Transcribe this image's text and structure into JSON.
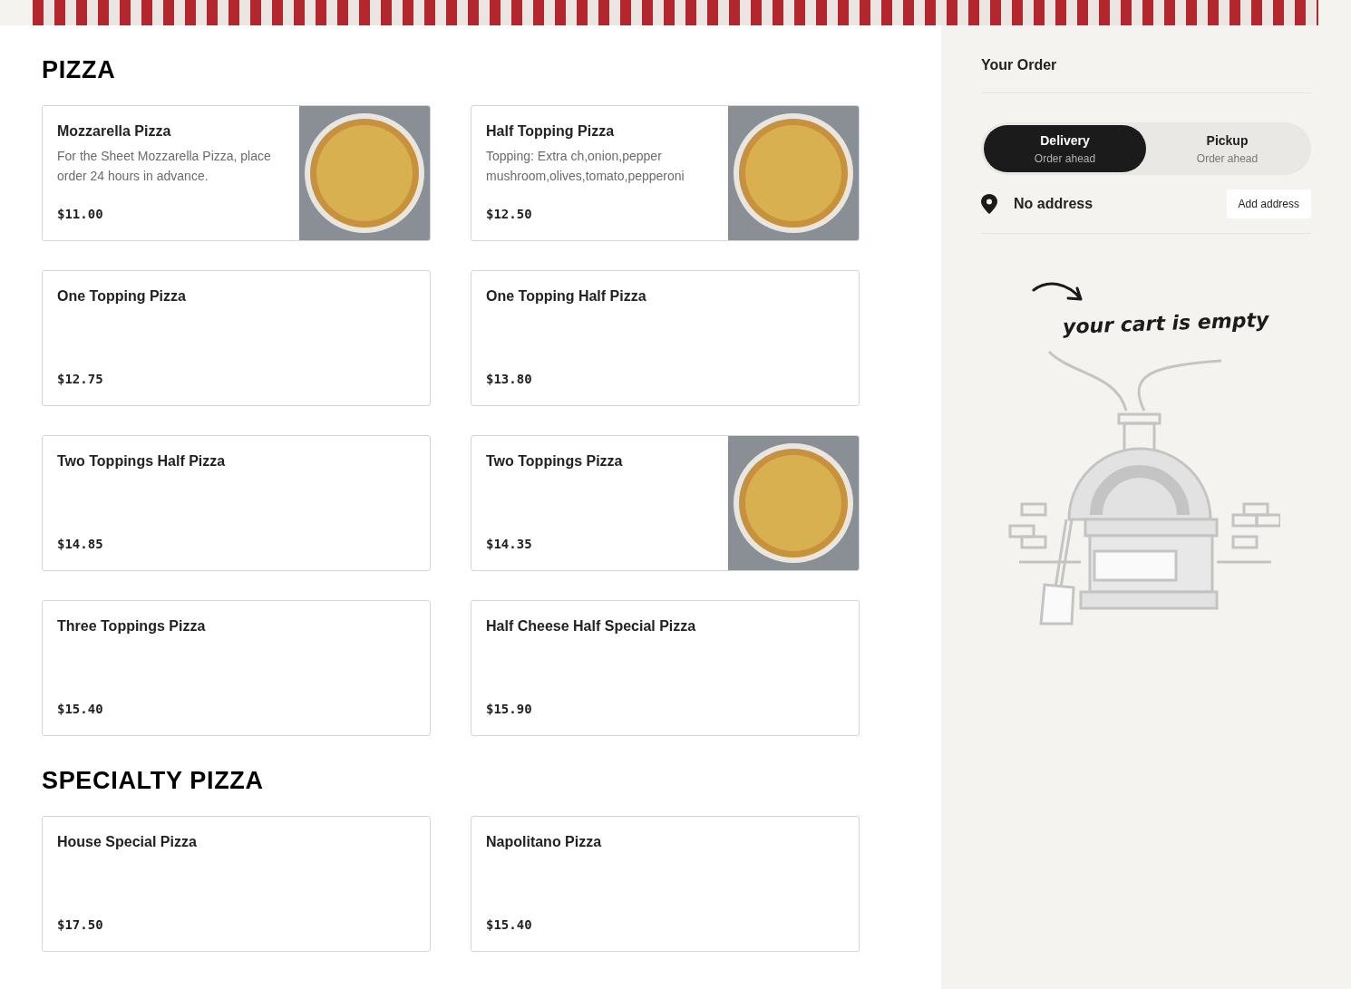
{
  "sections": [
    {
      "title": "PIZZA",
      "items": [
        {
          "name": "Mozzarella Pizza",
          "description": "For the Sheet Mozzarella Pizza, place order 24 hours in advance.",
          "price": "$11.00",
          "photo": true
        },
        {
          "name": "Half Topping Pizza",
          "description": "Topping: Extra ch,onion,pepper mushroom,olives,tomato,pepperoni",
          "price": "$12.50",
          "photo": true
        },
        {
          "name": "One Topping Pizza",
          "price": "$12.75",
          "photo": false
        },
        {
          "name": "One Topping Half Pizza",
          "price": "$13.80",
          "photo": false
        },
        {
          "name": "Two Toppings Half Pizza",
          "price": "$14.85",
          "photo": false
        },
        {
          "name": "Two Toppings Pizza",
          "price": "$14.35",
          "photo": true
        },
        {
          "name": "Three Toppings Pizza",
          "price": "$15.40",
          "photo": false
        },
        {
          "name": "Half Cheese Half Special Pizza",
          "price": "$15.90",
          "photo": false
        }
      ]
    },
    {
      "title": "SPECIALTY PIZZA",
      "items": [
        {
          "name": "House Special Pizza",
          "price": "$17.50",
          "photo": false
        },
        {
          "name": "Napolitano Pizza",
          "price": "$15.40",
          "photo": false
        }
      ]
    }
  ],
  "order": {
    "title": "Your Order",
    "modes": [
      {
        "label": "Delivery",
        "sublabel": "Order ahead",
        "selected": true
      },
      {
        "label": "Pickup",
        "sublabel": "Order ahead",
        "selected": false
      }
    ],
    "address": "No address",
    "add_address": "Add address",
    "empty_message": "your cart is empty"
  }
}
